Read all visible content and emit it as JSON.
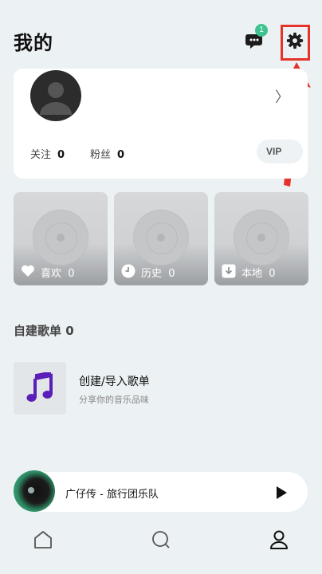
{
  "header": {
    "title": "我的",
    "message_badge": "1"
  },
  "profile": {
    "chevron": "〉",
    "follow_label": "关注",
    "follow_count": "0",
    "fans_label": "粉丝",
    "fans_count": "0",
    "vip_label": "VIP"
  },
  "shortcuts": [
    {
      "label": "喜欢",
      "count": "0",
      "icon": "heart-icon"
    },
    {
      "label": "历史",
      "count": "0",
      "icon": "clock-icon"
    },
    {
      "label": "本地",
      "count": "0",
      "icon": "download-icon"
    }
  ],
  "playlists": {
    "section_title": "自建歌单",
    "count": "0",
    "create_title": "创建/导入歌单",
    "create_subtitle": "分享你的音乐品味"
  },
  "player": {
    "track": "广仔传 - 旅行团乐队"
  },
  "nav": [
    {
      "name": "home-icon"
    },
    {
      "name": "search-icon"
    },
    {
      "name": "profile-icon"
    }
  ],
  "colors": {
    "accent": "#3ec28f",
    "annotation": "#e5332a",
    "background": "#ecf1f3",
    "note_icon": "#5a1fb8"
  }
}
